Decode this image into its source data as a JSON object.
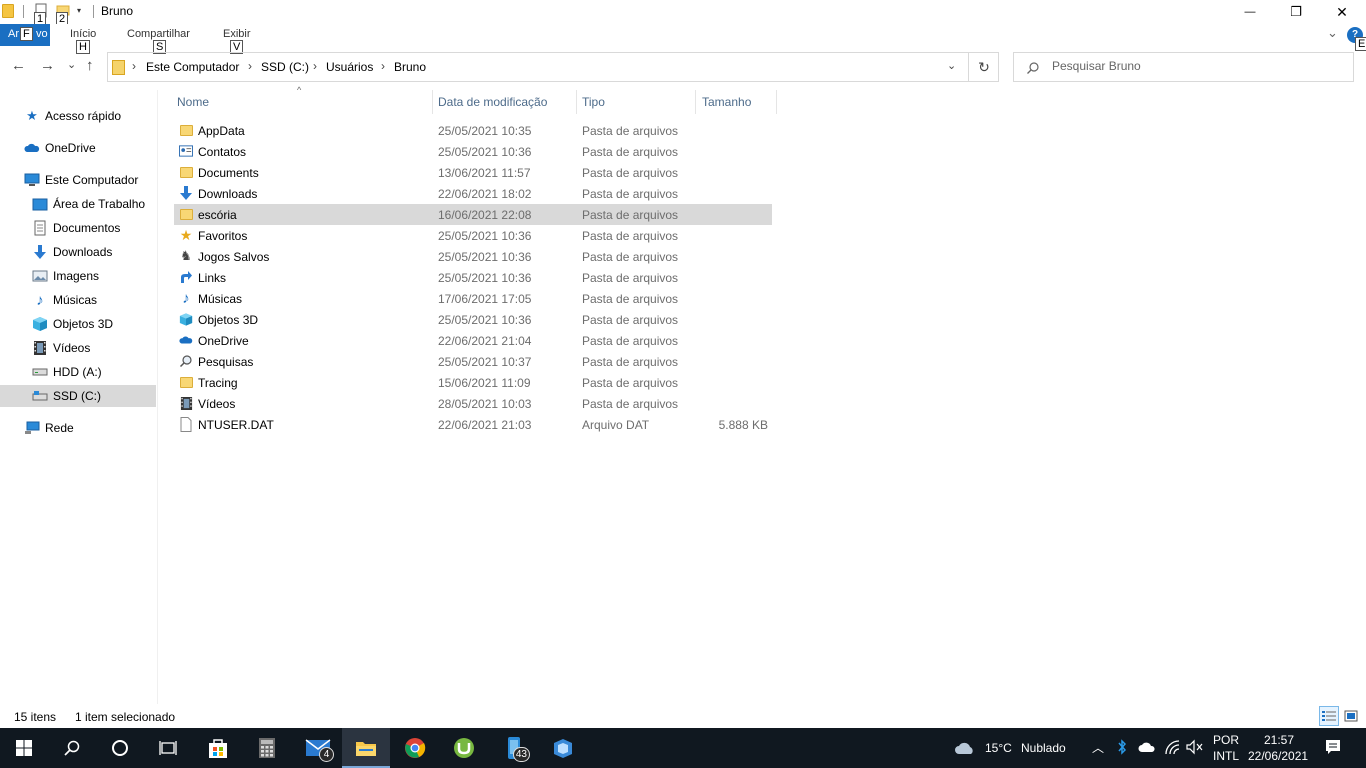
{
  "window": {
    "title": "Bruno",
    "minimize_glyph": "—",
    "restore_glyph": "❐",
    "close_glyph": "✕"
  },
  "quick_access": {
    "keytip_1": "1",
    "keytip_2": "2",
    "dropdown_glyph": "▾"
  },
  "ribbon": {
    "file_tab_prefix": "Ar",
    "file_keytip": "F",
    "file_tab_suffix": "vo",
    "tabs": [
      {
        "label": "Início",
        "keytip": "H"
      },
      {
        "label": "Compartilhar",
        "keytip": "S"
      },
      {
        "label": "Exibir",
        "keytip": "V"
      }
    ],
    "help_glyph": "?",
    "help_keytip": "E",
    "expand_glyph": "⌄"
  },
  "navigation": {
    "back_glyph": "←",
    "forward_glyph": "→",
    "recent_glyph": "⌄",
    "up_glyph": "↑"
  },
  "address_bar": {
    "breadcrumbs": [
      "Este Computador",
      "SSD (C:)",
      "Usuários",
      "Bruno"
    ],
    "separator": "›",
    "dropdown_glyph": "⌄",
    "refresh_glyph": "↻"
  },
  "search": {
    "placeholder": "Pesquisar Bruno",
    "value": ""
  },
  "nav_pane": {
    "items": [
      {
        "label": "Acesso rápido",
        "icon": "star-icon"
      },
      {
        "label": "OneDrive",
        "icon": "cloud-icon"
      },
      {
        "label": "Este Computador",
        "icon": "computer-icon"
      },
      {
        "label": "Área de Trabalho",
        "icon": "desktop-icon"
      },
      {
        "label": "Documentos",
        "icon": "document-icon"
      },
      {
        "label": "Downloads",
        "icon": "download-icon"
      },
      {
        "label": "Imagens",
        "icon": "image-icon"
      },
      {
        "label": "Músicas",
        "icon": "music-icon"
      },
      {
        "label": "Objetos 3D",
        "icon": "cube-icon"
      },
      {
        "label": "Vídeos",
        "icon": "film-icon"
      },
      {
        "label": "HDD (A:)",
        "icon": "drive-icon"
      },
      {
        "label": "SSD (C:)",
        "icon": "drive-icon",
        "selected": true
      },
      {
        "label": "Rede",
        "icon": "network-icon"
      }
    ]
  },
  "columns": {
    "name": "Nome",
    "date": "Data de modificação",
    "type": "Tipo",
    "size": "Tamanho",
    "sort_glyph": "^"
  },
  "files": [
    {
      "name": "AppData",
      "date": "25/05/2021 10:35",
      "type": "Pasta de arquivos",
      "size": "",
      "icon": "folder-icon"
    },
    {
      "name": "Contatos",
      "date": "25/05/2021 10:36",
      "type": "Pasta de arquivos",
      "size": "",
      "icon": "contacts-icon"
    },
    {
      "name": "Documents",
      "date": "13/06/2021 11:57",
      "type": "Pasta de arquivos",
      "size": "",
      "icon": "folder-icon"
    },
    {
      "name": "Downloads",
      "date": "22/06/2021 18:02",
      "type": "Pasta de arquivos",
      "size": "",
      "icon": "download-icon"
    },
    {
      "name": "escória",
      "date": "16/06/2021 22:08",
      "type": "Pasta de arquivos",
      "size": "",
      "icon": "folder-icon",
      "selected": true
    },
    {
      "name": "Favoritos",
      "date": "25/05/2021 10:36",
      "type": "Pasta de arquivos",
      "size": "",
      "icon": "star-icon"
    },
    {
      "name": "Jogos Salvos",
      "date": "25/05/2021 10:36",
      "type": "Pasta de arquivos",
      "size": "",
      "icon": "chess-icon"
    },
    {
      "name": "Links",
      "date": "25/05/2021 10:36",
      "type": "Pasta de arquivos",
      "size": "",
      "icon": "link-arrow-icon"
    },
    {
      "name": "Músicas",
      "date": "17/06/2021 17:05",
      "type": "Pasta de arquivos",
      "size": "",
      "icon": "music-icon"
    },
    {
      "name": "Objetos 3D",
      "date": "25/05/2021 10:36",
      "type": "Pasta de arquivos",
      "size": "",
      "icon": "cube-icon"
    },
    {
      "name": "OneDrive",
      "date": "22/06/2021 21:04",
      "type": "Pasta de arquivos",
      "size": "",
      "icon": "cloud-icon"
    },
    {
      "name": "Pesquisas",
      "date": "25/05/2021 10:37",
      "type": "Pasta de arquivos",
      "size": "",
      "icon": "search-icon"
    },
    {
      "name": "Tracing",
      "date": "15/06/2021 11:09",
      "type": "Pasta de arquivos",
      "size": "",
      "icon": "folder-icon"
    },
    {
      "name": "Vídeos",
      "date": "28/05/2021 10:03",
      "type": "Pasta de arquivos",
      "size": "",
      "icon": "film-icon"
    },
    {
      "name": "NTUSER.DAT",
      "date": "22/06/2021 21:03",
      "type": "Arquivo DAT",
      "size": "5.888 KB",
      "icon": "file-icon"
    }
  ],
  "status": {
    "item_count": "15 itens",
    "selection": "1 item selecionado"
  },
  "taskbar": {
    "mail_badge": "4",
    "phone_badge": "43",
    "weather_temp": "15°C",
    "weather_desc": "Nublado",
    "lang_1": "POR",
    "lang_2": "INTL",
    "time": "21:57",
    "date": "22/06/2021"
  },
  "colors": {
    "accent": "#1a6fc2",
    "selection": "#d9d9d9",
    "folder": "#f8d775",
    "taskbar": "#101820"
  }
}
